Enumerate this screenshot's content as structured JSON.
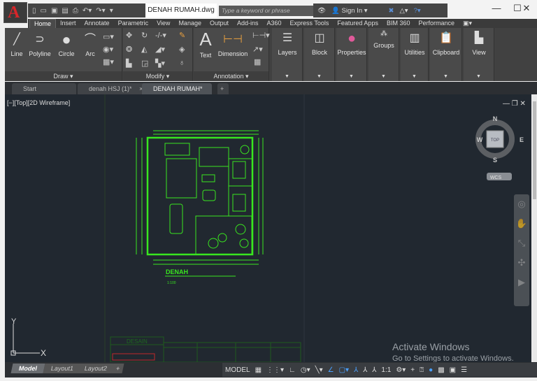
{
  "app": {
    "logo": "A",
    "document_title": "DENAH RUMAH.dwg",
    "search_placeholder": "Type a keyword or phrase",
    "sign_in": "Sign In"
  },
  "window_controls": {
    "minimize": "—",
    "maximize": "☐",
    "close": "✕"
  },
  "ribbon_tabs": [
    "Home",
    "Insert",
    "Annotate",
    "Parametric",
    "View",
    "Manage",
    "Output",
    "Add-ins",
    "A360",
    "Express Tools",
    "Featured Apps",
    "BIM 360",
    "Performance"
  ],
  "active_tab": "Home",
  "panels": {
    "draw": {
      "label": "Draw ▾",
      "tools": [
        "Line",
        "Polyline",
        "Circle",
        "Arc"
      ]
    },
    "modify": {
      "label": "Modify ▾"
    },
    "annotation": {
      "label": "Annotation ▾",
      "tools": [
        "Text",
        "Dimension"
      ]
    },
    "big": [
      "Layers",
      "Block",
      "Properties",
      "Groups",
      "Utilities",
      "Clipboard",
      "View"
    ]
  },
  "doc_tabs": [
    "Start",
    "denah HSJ (1)*",
    "DENAH RUMAH*"
  ],
  "viewport": {
    "controls": "[−][Top][2D Wireframe]",
    "viewcube": {
      "n": "N",
      "s": "S",
      "e": "E",
      "w": "W",
      "face": "TOP",
      "wcs": "WCS"
    },
    "ucs_y": "Y",
    "ucs_x": "X"
  },
  "drawing": {
    "title": "DENAH",
    "scale": "1:100",
    "title_block": "DESAIN",
    "line_color": "#39e61f"
  },
  "layout_tabs": [
    "Model",
    "Layout1",
    "Layout2"
  ],
  "status": {
    "model": "MODEL",
    "scale": "1:1"
  },
  "watermark": {
    "line1": "Activate Windows",
    "line2": "Go to Settings to activate Windows."
  }
}
